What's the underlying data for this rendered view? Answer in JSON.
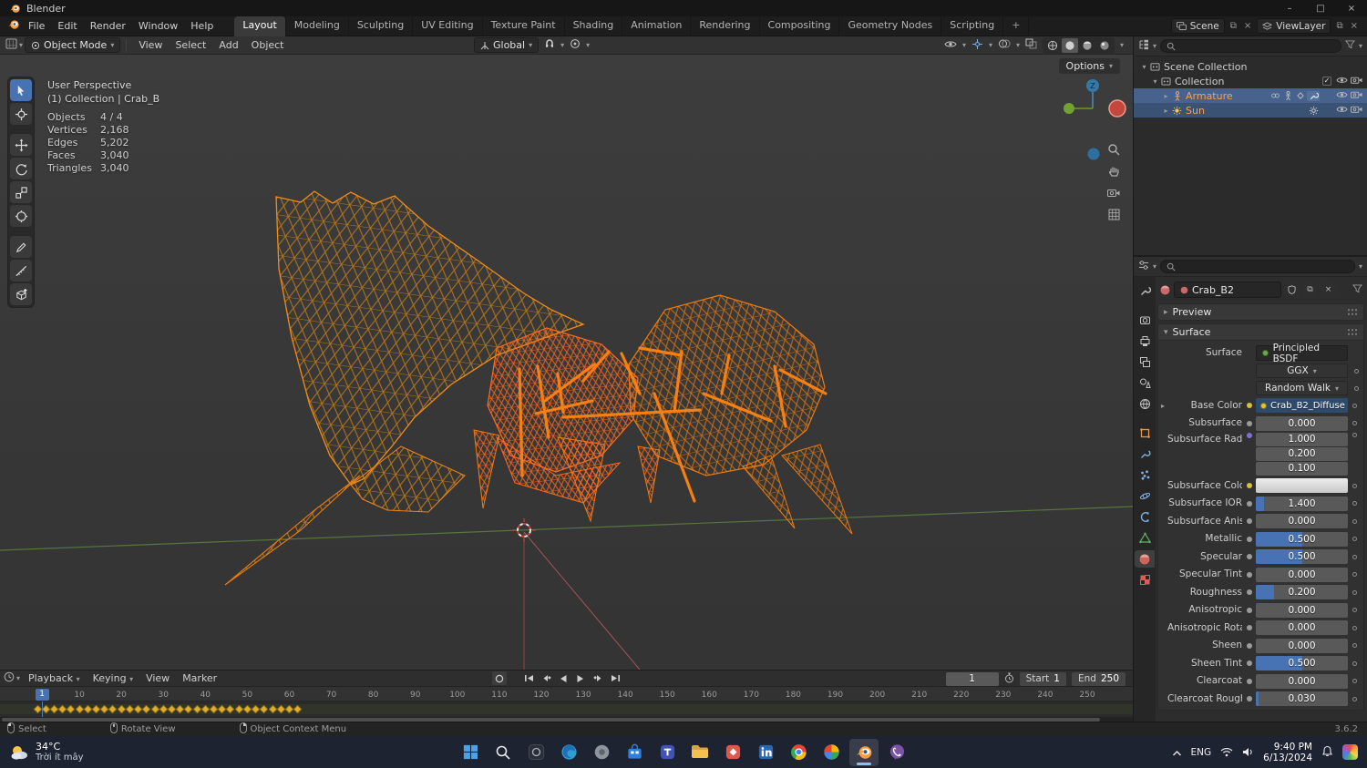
{
  "titlebar": {
    "title": "Blender"
  },
  "menubar": {
    "items": [
      "File",
      "Edit",
      "Render",
      "Window",
      "Help"
    ]
  },
  "workspaces": {
    "tabs": [
      "Layout",
      "Modeling",
      "Sculpting",
      "UV Editing",
      "Texture Paint",
      "Shading",
      "Animation",
      "Rendering",
      "Compositing",
      "Geometry Nodes",
      "Scripting"
    ],
    "active": "Layout",
    "add_label": "+"
  },
  "topbar_right": {
    "scene_label": "Scene",
    "viewlayer_label": "ViewLayer"
  },
  "tool_header": {
    "mode": "Object Mode",
    "menus": [
      "View",
      "Select",
      "Add",
      "Object"
    ],
    "orientation": "Global",
    "options_label": "Options"
  },
  "toolbar": {
    "tools": [
      "tweak-select",
      "cursor",
      "move",
      "rotate",
      "scale",
      "transform",
      "annotate",
      "measure",
      "add-cube"
    ],
    "active": "tweak-select"
  },
  "viewport": {
    "view_label": "User Perspective",
    "context_label": "(1) Collection | Crab_B",
    "stats": [
      {
        "label": "Objects",
        "value": "4 / 4"
      },
      {
        "label": "Vertices",
        "value": "2,168"
      },
      {
        "label": "Edges",
        "value": "5,202"
      },
      {
        "label": "Faces",
        "value": "3,040"
      },
      {
        "label": "Triangles",
        "value": "3,040"
      }
    ]
  },
  "outliner": {
    "items": [
      {
        "label": "Scene Collection",
        "level": 0,
        "icon": "collection",
        "selected": false,
        "extras": [],
        "toggles": []
      },
      {
        "label": "Collection",
        "level": 1,
        "icon": "collection",
        "selected": false,
        "extras": [],
        "toggles": [
          "checkbox",
          "eye",
          "camera"
        ]
      },
      {
        "label": "Armature",
        "level": 2,
        "icon": "armature",
        "selected": true,
        "selstyle": "sel1",
        "extras": [
          "link",
          "pose",
          "key",
          "modifier"
        ],
        "toggles": [
          "eye",
          "camera"
        ]
      },
      {
        "label": "Sun",
        "level": 2,
        "icon": "light",
        "selected": true,
        "selstyle": "sel2",
        "extras": [
          "sun"
        ],
        "toggles": [
          "eye",
          "camera"
        ]
      }
    ]
  },
  "properties": {
    "breadcrumb_name": "Crab_B2",
    "preview_label": "Preview",
    "surface_label": "Surface",
    "surface_row": {
      "label": "Surface",
      "value": "Principled BSDF"
    },
    "enum1": "GGX",
    "enum2": "Random Walk",
    "tabs": [
      "tool",
      "render",
      "output",
      "view-layer",
      "scene",
      "world",
      "object",
      "modifiers",
      "particles",
      "physics",
      "constraints",
      "object-data",
      "material",
      "texture"
    ],
    "active_tab": "material",
    "rows": [
      {
        "label": "Base Color",
        "type": "texture",
        "value": "Crab_B2_Diffuse",
        "expander": true,
        "dot": "#d7c13a"
      },
      {
        "label": "Subsurface",
        "type": "slider",
        "value": "0.000",
        "fill": 0
      },
      {
        "label": "Subsurface Radius",
        "type": "multi",
        "values": [
          "1.000",
          "0.200",
          "0.100"
        ],
        "dot": "#7d6fd9"
      },
      {
        "label": "Subsurface Color",
        "type": "color",
        "dot": "#d7c13a"
      },
      {
        "label": "Subsurface IOR",
        "type": "slider",
        "value": "1.400",
        "fill": 0.09
      },
      {
        "label": "Subsurface Aniso...",
        "type": "slider",
        "value": "0.000",
        "fill": 0
      },
      {
        "label": "Metallic",
        "type": "slider",
        "value": "0.500",
        "fill": 0.5
      },
      {
        "label": "Specular",
        "type": "slider",
        "value": "0.500",
        "fill": 0.5
      },
      {
        "label": "Specular Tint",
        "type": "slider",
        "value": "0.000",
        "fill": 0
      },
      {
        "label": "Roughness",
        "type": "slider",
        "value": "0.200",
        "fill": 0.2
      },
      {
        "label": "Anisotropic",
        "type": "slider",
        "value": "0.000",
        "fill": 0
      },
      {
        "label": "Anisotropic Rota...",
        "type": "slider",
        "value": "0.000",
        "fill": 0
      },
      {
        "label": "Sheen",
        "type": "slider",
        "value": "0.000",
        "fill": 0
      },
      {
        "label": "Sheen Tint",
        "type": "slider",
        "value": "0.500",
        "fill": 0.5
      },
      {
        "label": "Clearcoat",
        "type": "slider",
        "value": "0.000",
        "fill": 0
      },
      {
        "label": "Clearcoat Rough...",
        "type": "slider",
        "value": "0.030",
        "fill": 0.03
      }
    ]
  },
  "timeline": {
    "menus": [
      "Playback",
      "Keying",
      "View",
      "Marker"
    ],
    "frame_field": "1",
    "current_frame": "1",
    "start_label": "Start",
    "start_value": "1",
    "end_label": "End",
    "end_value": "250",
    "ticks": [
      10,
      20,
      30,
      40,
      50,
      60,
      70,
      80,
      90,
      100,
      110,
      120,
      130,
      140,
      150,
      160,
      170,
      180,
      190,
      200,
      210,
      220,
      230,
      240,
      250
    ],
    "keyframes": {
      "first": 0,
      "last": 62,
      "step": 2
    }
  },
  "statusbar": {
    "hints": [
      {
        "icon": "mouse-left",
        "label": "Select"
      },
      {
        "icon": "mouse-middle",
        "label": "Rotate View"
      },
      {
        "icon": "mouse-right",
        "label": "Object Context Menu"
      }
    ],
    "version": "3.6.2"
  },
  "taskbar": {
    "weather": {
      "temp": "34°C",
      "desc": "Trời ít mây"
    },
    "apps": [
      "start",
      "search",
      "photos-dark",
      "edge",
      "gray-app",
      "store",
      "blue-app",
      "explorer",
      "red-app",
      "blue-tile",
      "chrome",
      "google",
      "blender",
      "viber"
    ],
    "active_app": "blender",
    "tray": {
      "lang": "ENG",
      "time": "9:40 PM",
      "date": "6/13/2024"
    }
  }
}
